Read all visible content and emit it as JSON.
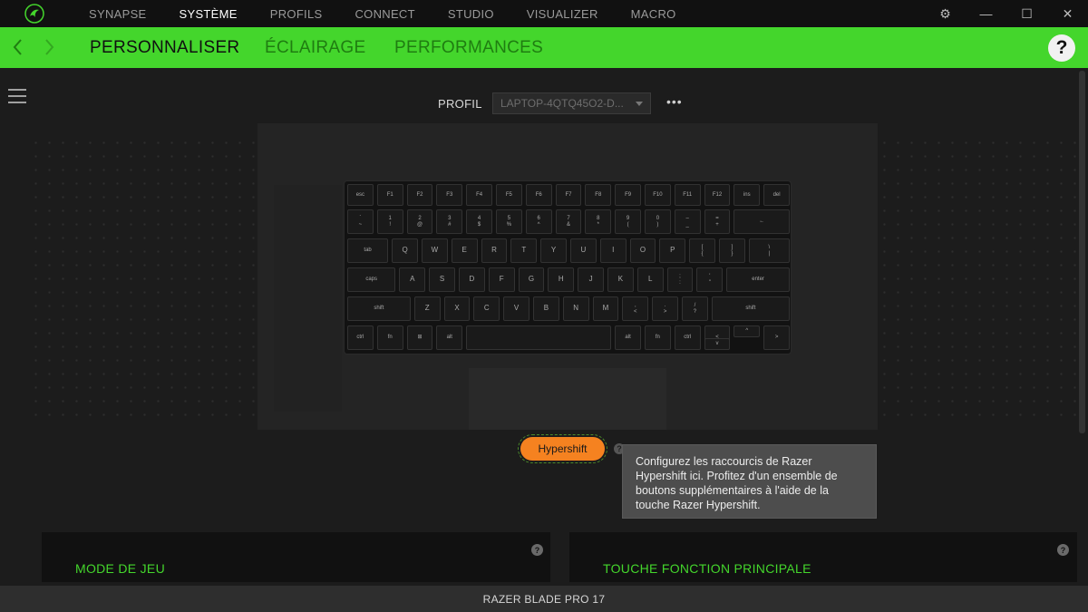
{
  "topnav": {
    "items": [
      "SYNAPSE",
      "SYSTÈME",
      "PROFILS",
      "CONNECT",
      "STUDIO",
      "VISUALIZER",
      "MACRO"
    ],
    "active_index": 1
  },
  "window_controls": {
    "settings": "⚙",
    "minimize": "—",
    "maximize": "☐",
    "close": "✕"
  },
  "subnav": {
    "tabs": [
      "PERSONNALISER",
      "ÉCLAIRAGE",
      "PERFORMANCES"
    ],
    "active_index": 0,
    "help": "?"
  },
  "profile": {
    "label": "PROFIL",
    "selected": "LAPTOP-4QTQ45O2-D...",
    "more": "•••"
  },
  "keyboard": {
    "rows": [
      [
        "esc",
        "F1",
        "F2",
        "F3",
        "F4",
        "F5",
        "F6",
        "F7",
        "F8",
        "F9",
        "F10",
        "F11",
        "F12",
        "ins",
        "del"
      ],
      [
        "`",
        "1",
        "2",
        "3",
        "4",
        "5",
        "6",
        "7",
        "8",
        "9",
        "0",
        "–",
        "=",
        "←"
      ],
      [
        "tab",
        "Q",
        "W",
        "E",
        "R",
        "T",
        "Y",
        "U",
        "I",
        "O",
        "P",
        "[",
        "]",
        "\\"
      ],
      [
        "caps",
        "A",
        "S",
        "D",
        "F",
        "G",
        "H",
        "J",
        "K",
        "L",
        ";",
        "'",
        "enter"
      ],
      [
        "shift",
        "Z",
        "X",
        "C",
        "V",
        "B",
        "N",
        "M",
        ",",
        ".",
        "/",
        "shift"
      ],
      [
        "ctrl",
        "fn",
        "⊞",
        "alt",
        "",
        "alt",
        "fn",
        "ctrl",
        "<",
        "^",
        "v",
        ">"
      ]
    ],
    "shift_labels": {
      "`": "~",
      "1": "!",
      "2": "@",
      "3": "#",
      "4": "$",
      "5": "%",
      "6": "^",
      "7": "&",
      "8": "*",
      "9": "(",
      "0": ")",
      "–": "_",
      "=": "+",
      "[": "{",
      "]": "}",
      "\\": "|",
      ";": ":",
      "'": "\"",
      ",": "<",
      ".": ">",
      "/": "?"
    }
  },
  "hypershift": {
    "label": "Hypershift",
    "help": "?",
    "tooltip": "Configurez les raccourcis de Razer Hypershift ici. Profitez d'un ensemble de boutons supplémentaires à l'aide de la touche Razer Hypershift."
  },
  "panels": {
    "left": {
      "title": "MODE DE JEU",
      "help": "?"
    },
    "right": {
      "title": "TOUCHE FONCTION PRINCIPALE",
      "help": "?"
    }
  },
  "footer": {
    "device": "RAZER BLADE PRO 17"
  },
  "colors": {
    "accent": "#44d62c",
    "hypershift": "#f58220",
    "background": "#1c1c1c"
  }
}
